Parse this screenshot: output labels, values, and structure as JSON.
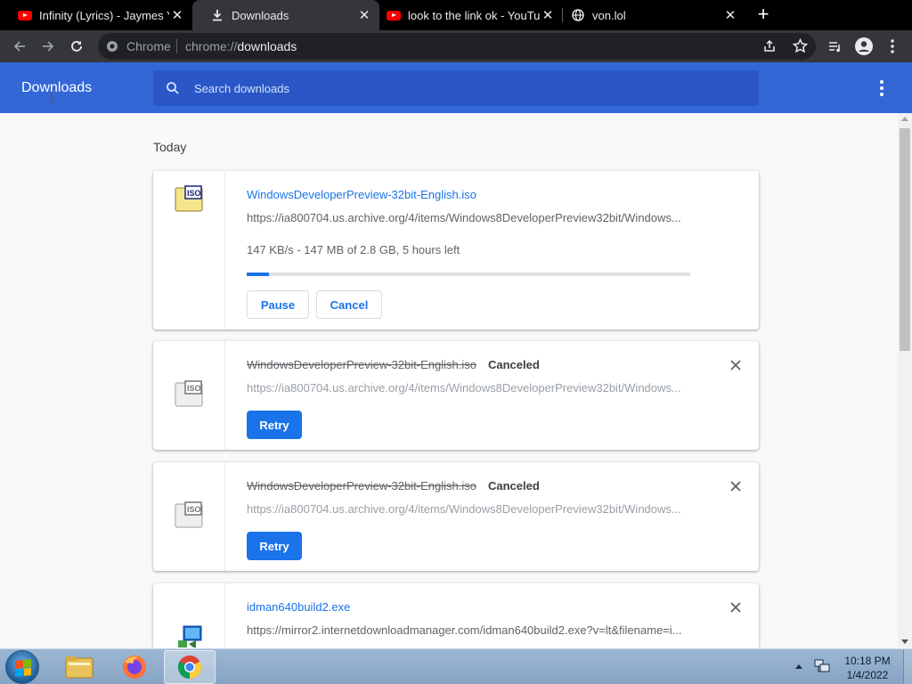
{
  "tabs": [
    {
      "title": "Infinity (Lyrics) - Jaymes Yo",
      "icon": "youtube-icon"
    },
    {
      "title": "Downloads",
      "icon": "download-icon"
    },
    {
      "title": "look to the link ok - YouTul",
      "icon": "youtube-icon"
    },
    {
      "title": "von.lol",
      "icon": "globe-icon"
    }
  ],
  "omnibox": {
    "label": "Chrome",
    "scheme": "chrome://",
    "path": "downloads"
  },
  "header": {
    "title": "Downloads",
    "search_placeholder": "Search downloads"
  },
  "date_group": "Today",
  "downloads": [
    {
      "filename": "WindowsDeveloperPreview-32bit-English.iso",
      "url": "https://ia800704.us.archive.org/4/items/Windows8DeveloperPreview32bit/Windows...",
      "progress_text": "147 KB/s - 147 MB of 2.8 GB, 5 hours left",
      "progress_fraction": 0.05,
      "pause_label": "Pause",
      "cancel_label": "Cancel"
    },
    {
      "filename": "WindowsDeveloperPreview-32bit-English.iso",
      "status": "Canceled",
      "url": "https://ia800704.us.archive.org/4/items/Windows8DeveloperPreview32bit/Windows...",
      "retry_label": "Retry"
    },
    {
      "filename": "WindowsDeveloperPreview-32bit-English.iso",
      "status": "Canceled",
      "url": "https://ia800704.us.archive.org/4/items/Windows8DeveloperPreview32bit/Windows...",
      "retry_label": "Retry"
    },
    {
      "filename": "idman640build2.exe",
      "url": "https://mirror2.internetdownloadmanager.com/idman640build2.exe?v=lt&filename=i..."
    }
  ],
  "taskbar": {
    "time": "10:18 PM",
    "date": "1/4/2022"
  },
  "colors": {
    "accent": "#1a73e8",
    "header_bg": "#3367d6",
    "search_bg": "#2a56c6"
  }
}
